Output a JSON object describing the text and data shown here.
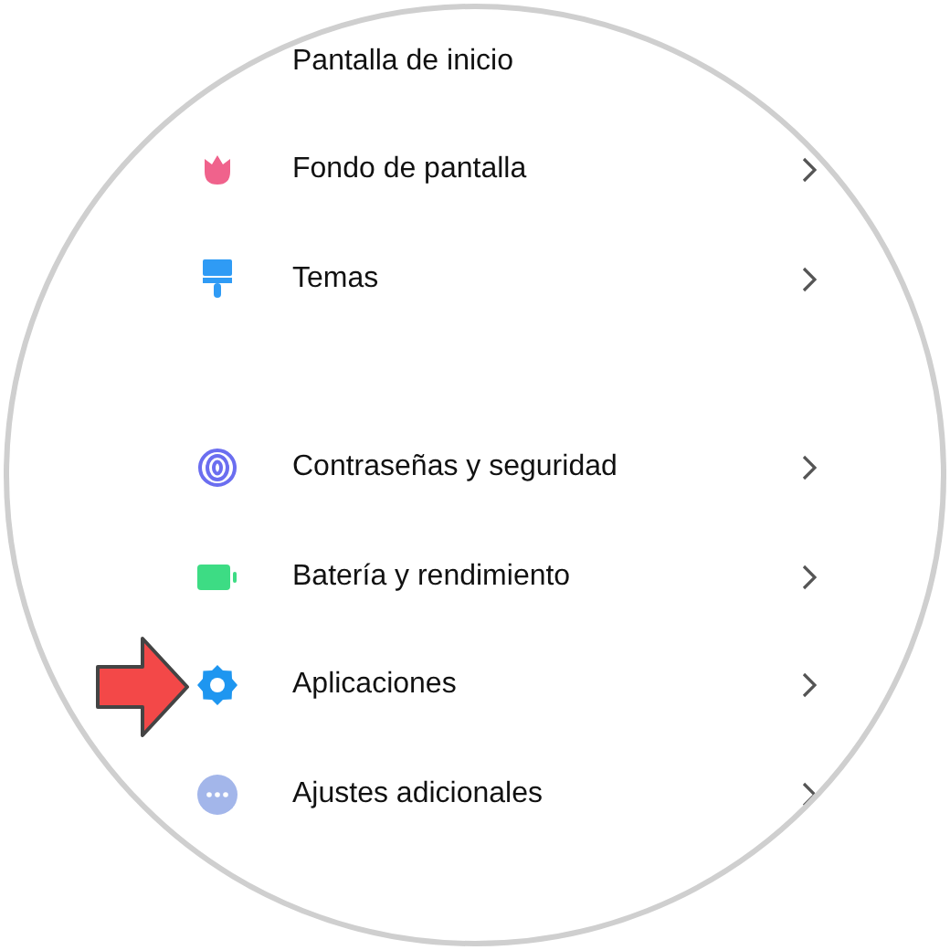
{
  "settings": [
    {
      "label": "Pantalla de inicio",
      "kind": "plain"
    },
    {
      "label": "Fondo de pantalla",
      "kind": "wallpaper"
    },
    {
      "label": "Temas",
      "kind": "themes",
      "group_end": true
    },
    {
      "label": "Contraseñas y seguridad",
      "kind": "security"
    },
    {
      "label": "Batería y rendimiento",
      "kind": "battery"
    },
    {
      "label": "Aplicaciones",
      "kind": "apps",
      "highlighted": true
    },
    {
      "label": "Ajustes adicionales",
      "kind": "more"
    }
  ]
}
